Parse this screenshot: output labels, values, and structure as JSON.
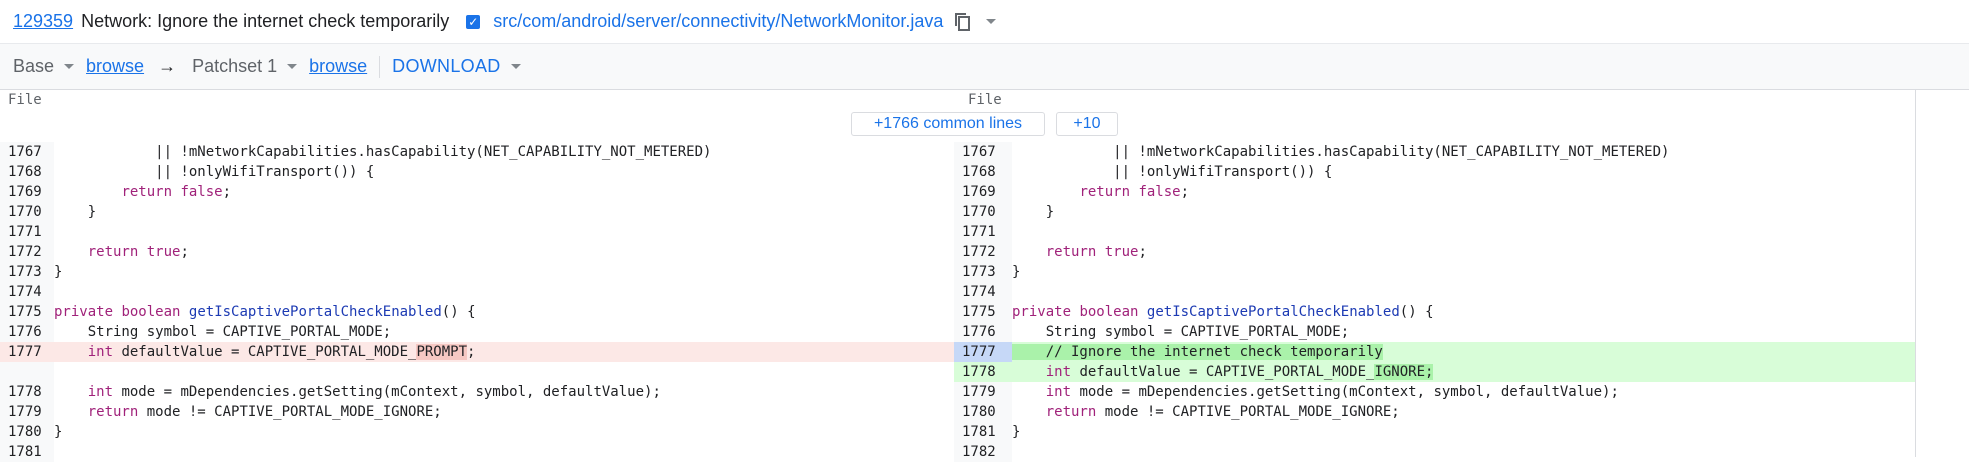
{
  "header": {
    "change_number": "129359",
    "change_title": "Network: Ignore the internet check temporarily",
    "file_path": "src/com/android/server/connectivity/NetworkMonitor.java"
  },
  "toolbar": {
    "base_label": "Base",
    "browse_label": "browse",
    "arrow": "→",
    "patchset_label": "Patchset 1",
    "download_label": "DOWNLOAD"
  },
  "diff": {
    "left_header": "File",
    "right_header": "File",
    "common_lines_label": "+1766 common lines",
    "expand_label": "+10",
    "rows": [
      {
        "l_num": "1767",
        "l_code": "            || !mNetworkCapabilities.hasCapability(NET_CAPABILITY_NOT_METERED)",
        "r_num": "1767",
        "r_code": "            || !mNetworkCapabilities.hasCapability(NET_CAPABILITY_NOT_METERED)"
      },
      {
        "l_num": "1768",
        "l_code": "            || !onlyWifiTransport()) {",
        "r_num": "1768",
        "r_code": "            || !onlyWifiTransport()) {"
      },
      {
        "l_num": "1769",
        "l_code": "        return false;",
        "r_num": "1769",
        "r_code": "        return false;"
      },
      {
        "l_num": "1770",
        "l_code": "    }",
        "r_num": "1770",
        "r_code": "    }"
      },
      {
        "l_num": "1771",
        "l_code": "",
        "r_num": "1771",
        "r_code": ""
      },
      {
        "l_num": "1772",
        "l_code": "    return true;",
        "r_num": "1772",
        "r_code": "    return true;"
      },
      {
        "l_num": "1773",
        "l_code": "}",
        "r_num": "1773",
        "r_code": "}"
      },
      {
        "l_num": "1774",
        "l_code": "",
        "r_num": "1774",
        "r_code": ""
      },
      {
        "l_num": "1775",
        "l_code": "private boolean getIsCaptivePortalCheckEnabled() {",
        "r_num": "1775",
        "r_code": "private boolean getIsCaptivePortalCheckEnabled() {"
      },
      {
        "l_num": "1776",
        "l_code": "    String symbol = CAPTIVE_PORTAL_MODE;",
        "r_num": "1776",
        "r_code": "    String symbol = CAPTIVE_PORTAL_MODE;"
      },
      {
        "l_num": "1777",
        "l_code": "    int defaultValue = CAPTIVE_PORTAL_MODE_PROMPT;",
        "r_num": "1777",
        "r_code": "    // Ignore the internet check temporarily"
      },
      {
        "l_num": "",
        "l_code": "",
        "r_num": "1778",
        "r_code": "    int defaultValue = CAPTIVE_PORTAL_MODE_IGNORE;"
      },
      {
        "l_num": "1778",
        "l_code": "    int mode = mDependencies.getSetting(mContext, symbol, defaultValue);",
        "r_num": "1779",
        "r_code": "    int mode = mDependencies.getSetting(mContext, symbol, defaultValue);"
      },
      {
        "l_num": "1779",
        "l_code": "    return mode != CAPTIVE_PORTAL_MODE_IGNORE;",
        "r_num": "1780",
        "r_code": "    return mode != CAPTIVE_PORTAL_MODE_IGNORE;"
      },
      {
        "l_num": "1780",
        "l_code": "}",
        "r_num": "1781",
        "r_code": "}"
      },
      {
        "l_num": "1781",
        "l_code": "",
        "r_num": "1782",
        "r_code": ""
      }
    ]
  },
  "colors": {
    "link": "#1a73e8",
    "removed_bg": "#fce8e6",
    "added_bg": "#d8fdd8",
    "added_line_number_bg": "#c6d8f7"
  },
  "icons": [
    "checkbox-checked-icon",
    "copy-icon",
    "dropdown-arrow-icon"
  ]
}
